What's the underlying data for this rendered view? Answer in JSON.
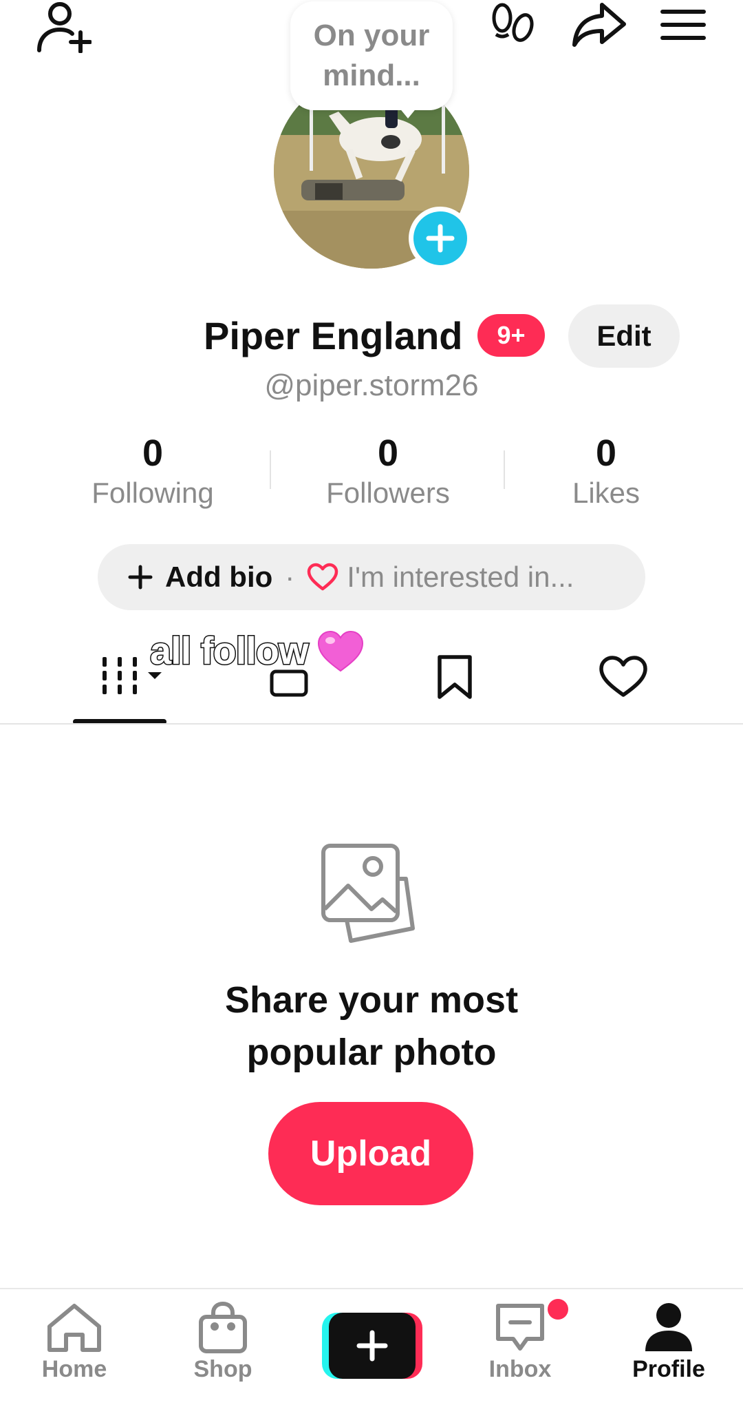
{
  "top_bar": {
    "add_friend_icon": "person-add-icon",
    "footprints_icon": "footprints-icon",
    "share_icon": "share-arrow-icon",
    "menu_icon": "hamburger-menu-icon"
  },
  "bubble": {
    "text": "On your mind..."
  },
  "profile": {
    "name": "Piper England",
    "notification_badge": "9+",
    "edit_label": "Edit",
    "handle": "@piper.storm26"
  },
  "stats": [
    {
      "value": "0",
      "label": "Following"
    },
    {
      "value": "0",
      "label": "Followers"
    },
    {
      "value": "0",
      "label": "Likes"
    }
  ],
  "bio": {
    "add_label": "Add bio",
    "separator": "·",
    "interest_label": "I'm interested in..."
  },
  "overlay": {
    "text": "all follow",
    "emoji": "💗"
  },
  "tabs": [
    {
      "name": "videos-grid",
      "icon": "grid-icon",
      "active": true
    },
    {
      "name": "reposts",
      "icon": "repost-icon",
      "active": false
    },
    {
      "name": "saved",
      "icon": "bookmark-icon",
      "active": false
    },
    {
      "name": "liked",
      "icon": "heart-icon",
      "active": false
    }
  ],
  "empty_state": {
    "icon": "photos-icon",
    "title_line1": "Share your most",
    "title_line2": "popular photo",
    "upload_label": "Upload"
  },
  "bottom_nav": [
    {
      "label": "Home",
      "icon": "home-icon",
      "active": false
    },
    {
      "label": "Shop",
      "icon": "shopping-bag-icon",
      "active": false
    },
    {
      "label": "",
      "icon": "create-plus-icon",
      "active": false
    },
    {
      "label": "Inbox",
      "icon": "inbox-icon",
      "active": false,
      "notification_dot": true
    },
    {
      "label": "Profile",
      "icon": "profile-icon",
      "active": true
    }
  ],
  "colors": {
    "accent": "#fe2c55",
    "avatar_add": "#20c4e8",
    "secondary_text": "#8a8a8a"
  }
}
